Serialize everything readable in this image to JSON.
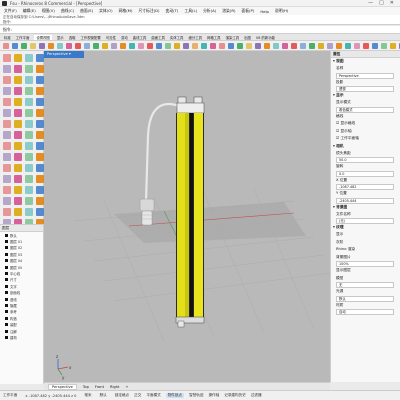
{
  "window": {
    "title": "Fsu - Rhinoceros 8 Commercial - [Perspective]",
    "controls": [
      "—",
      "□",
      "✕"
    ]
  },
  "menu": [
    "文件(F)",
    "编辑(E)",
    "视图(V)",
    "曲线(C)",
    "曲面(S)",
    "实体(O)",
    "网格(M)",
    "尺寸标注(D)",
    "变动(T)",
    "工具(L)",
    "分析(A)",
    "渲染(R)",
    "面板(P)",
    "Help",
    "说明(H)"
  ],
  "command_history": {
    "line1": "正在自动保存到 C:\\Users\\...\\RhinoAutoSave.3dm",
    "line2": "指令:"
  },
  "command_prompt": "指令:",
  "tabs": {
    "items": [
      "标准",
      "工作平面",
      "设置视图",
      "显示",
      "选取",
      "工作视窗配置",
      "可见性",
      "变动",
      "曲线工具",
      "曲面工具",
      "实体工具",
      "细分工具",
      "网格工具",
      "渲染工具",
      "出图",
      "V8 的新功能"
    ],
    "active_index": 2
  },
  "icon_colors": [
    "#e04040",
    "#3a78c8",
    "#2ea44f",
    "#d9a400",
    "#7b5ea7",
    "#e07b00",
    "#2aa8a8",
    "#d04a8a"
  ],
  "viewport": {
    "label": "Perspective ▾",
    "axes": {
      "x": "x",
      "y": "y",
      "z": "z"
    }
  },
  "layers": {
    "header": "图层",
    "items": [
      "默认",
      "图层 01",
      "图层 02",
      "图层 03",
      "图层 04",
      "图层 05",
      "中心线",
      "尺寸",
      "文字",
      "剖面线",
      "虚线",
      "隐藏",
      "参考",
      "构造",
      "装配",
      "注解",
      "建构"
    ]
  },
  "right_panel": {
    "title": "属性",
    "sections": [
      {
        "type": "sec",
        "text": "▾ 视图"
      },
      {
        "type": "row",
        "text": "名称"
      },
      {
        "type": "box",
        "text": "Perspective"
      },
      {
        "type": "row",
        "text": "投影"
      },
      {
        "type": "box",
        "text": "透视"
      },
      {
        "type": "sec",
        "text": "▾ 显示"
      },
      {
        "type": "row",
        "text": "显示模式"
      },
      {
        "type": "box",
        "text": "着色模式"
      },
      {
        "type": "row",
        "text": "格线"
      },
      {
        "type": "row",
        "text": "☑ 显示格线"
      },
      {
        "type": "row",
        "text": "☑ 显示轴"
      },
      {
        "type": "row",
        "text": "☑ 工作平面轴"
      },
      {
        "type": "sec",
        "text": "▾ 相机"
      },
      {
        "type": "row",
        "text": "镜头焦距"
      },
      {
        "type": "box",
        "text": "50.0"
      },
      {
        "type": "row",
        "text": "旋转"
      },
      {
        "type": "box",
        "text": "0.0"
      },
      {
        "type": "row",
        "text": "X 位置"
      },
      {
        "type": "box",
        "text": "-1087.482"
      },
      {
        "type": "row",
        "text": "Y 位置"
      },
      {
        "type": "box",
        "text": "-2405.444"
      },
      {
        "type": "sec",
        "text": "▾ 背景图"
      },
      {
        "type": "row",
        "text": "文件名称"
      },
      {
        "type": "box",
        "text": "(无)"
      },
      {
        "type": "sec",
        "text": "▾ 纹理"
      },
      {
        "type": "row",
        "text": "显示"
      },
      {
        "type": "row",
        "text": "灰阶"
      },
      {
        "type": "row",
        "text": "Rhino 渲染"
      },
      {
        "type": "row",
        "text": "背景图片"
      },
      {
        "type": "box",
        "text": "100%"
      },
      {
        "type": "row",
        "text": "显示图层"
      },
      {
        "type": "row",
        "text": "模型"
      },
      {
        "type": "box",
        "text": "无"
      },
      {
        "type": "row",
        "text": "光源"
      },
      {
        "type": "box",
        "text": "默认"
      },
      {
        "type": "row",
        "text": "材质"
      },
      {
        "type": "box",
        "text": "自动"
      }
    ]
  },
  "view_tabs": [
    "Perspective",
    "Top",
    "Front",
    "Right",
    "+"
  ],
  "status": {
    "plane": "工作平面",
    "coords": "x -1087.482   y -2405.444   z 0",
    "unit": "毫米",
    "layer": "默认",
    "snaps": [
      "锁定格点",
      "正交",
      "平面模式",
      "物件锁点",
      "智慧轨迹",
      "操作轴",
      "记录建构历史",
      "过滤器"
    ],
    "active_snap": "物件锁点"
  }
}
